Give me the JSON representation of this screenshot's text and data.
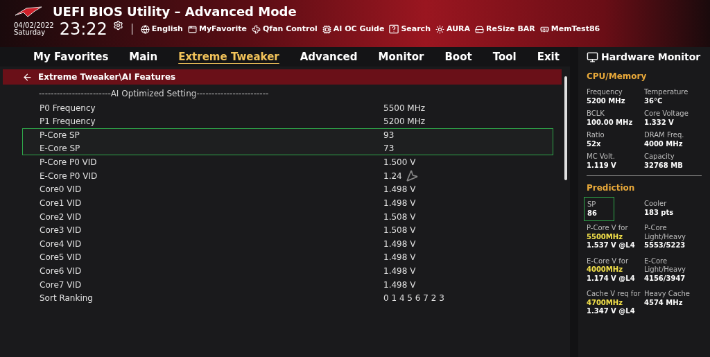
{
  "header": {
    "title": "UEFI BIOS Utility – Advanced Mode",
    "date": "04/02/2022",
    "day": "Saturday",
    "time": "23:22",
    "toolbar": [
      {
        "kind": "language",
        "label": "English"
      },
      {
        "kind": "favorite",
        "label": "MyFavorite"
      },
      {
        "kind": "fan",
        "label": "Qfan Control"
      },
      {
        "kind": "ai",
        "label": "AI OC Guide"
      },
      {
        "kind": "search",
        "label": "Search"
      },
      {
        "kind": "aura",
        "label": "AURA"
      },
      {
        "kind": "resize",
        "label": "ReSize BAR"
      },
      {
        "kind": "memtest",
        "label": "MemTest86"
      }
    ]
  },
  "tabs": [
    {
      "label": "My Favorites",
      "selected": false
    },
    {
      "label": "Main",
      "selected": false
    },
    {
      "label": "Extreme Tweaker",
      "selected": true
    },
    {
      "label": "Advanced",
      "selected": false
    },
    {
      "label": "Monitor",
      "selected": false
    },
    {
      "label": "Boot",
      "selected": false
    },
    {
      "label": "Tool",
      "selected": false
    },
    {
      "label": "Exit",
      "selected": false
    }
  ],
  "breadcrumb": "Extreme Tweaker\\AI Features",
  "section_heading": "------------------------AI Optimized Setting------------------------",
  "rows": [
    {
      "label": "P0 Frequency",
      "value": "5500 MHz",
      "highlighted": false
    },
    {
      "label": "P1 Frequency",
      "value": "5200 MHz",
      "highlighted": false
    },
    {
      "label": "P-Core SP",
      "value": "93",
      "highlighted": true
    },
    {
      "label": "E-Core SP",
      "value": "73",
      "highlighted": true
    },
    {
      "label": "P-Core P0 VID",
      "value": "1.500 V",
      "highlighted": false
    },
    {
      "label": "E-Core P0 VID",
      "value": "1.24",
      "highlighted": false
    },
    {
      "label": "Core0 VID",
      "value": "1.498 V",
      "highlighted": false
    },
    {
      "label": "Core1 VID",
      "value": "1.498 V",
      "highlighted": false
    },
    {
      "label": "Core2 VID",
      "value": "1.508 V",
      "highlighted": false
    },
    {
      "label": "Core3 VID",
      "value": "1.508 V",
      "highlighted": false
    },
    {
      "label": "Core4 VID",
      "value": "1.498 V",
      "highlighted": false
    },
    {
      "label": "Core5 VID",
      "value": "1.498 V",
      "highlighted": false
    },
    {
      "label": "Core6 VID",
      "value": "1.498 V",
      "highlighted": false
    },
    {
      "label": "Core7 VID",
      "value": "1.498 V",
      "highlighted": false
    },
    {
      "label": "Sort Ranking",
      "value": "0 1 4 5 6 7 2 3",
      "highlighted": false
    }
  ],
  "hardware_monitor": {
    "title": "Hardware Monitor",
    "cpu_memory": {
      "heading": "CPU/Memory",
      "items": [
        {
          "label": "Frequency",
          "value": "5200 MHz"
        },
        {
          "label": "Temperature",
          "value": "36°C"
        },
        {
          "label": "BCLK",
          "value": "100.00 MHz"
        },
        {
          "label": "Core Voltage",
          "value": "1.332 V"
        },
        {
          "label": "Ratio",
          "value": "52x"
        },
        {
          "label": "DRAM Freq.",
          "value": "4000 MHz"
        },
        {
          "label": "MC Volt.",
          "value": "1.119 V"
        },
        {
          "label": "Capacity",
          "value": "32768 MB"
        }
      ]
    },
    "prediction": {
      "heading": "Prediction",
      "items": [
        {
          "label": "SP",
          "value": "86",
          "highlighted": true
        },
        {
          "label": "Cooler",
          "value": "183 pts",
          "highlighted": false
        },
        {
          "label": "P-Core V for",
          "freq": "5500MHz",
          "value": "1.537 V @L4",
          "highlighted": false
        },
        {
          "label": "P-Core Light/Heavy",
          "value": "5553/5223",
          "highlighted": false
        },
        {
          "label": "E-Core V for",
          "freq": "4000MHz",
          "value": "1.174 V @L4",
          "highlighted": false
        },
        {
          "label": "E-Core Light/Heavy",
          "value": "4156/3947",
          "highlighted": false
        },
        {
          "label": "Cache V req for",
          "freq": "4700MHz",
          "value": "1.347 V @L4",
          "highlighted": false
        },
        {
          "label": "Heavy Cache",
          "value": "4574 MHz",
          "highlighted": false
        }
      ]
    }
  }
}
